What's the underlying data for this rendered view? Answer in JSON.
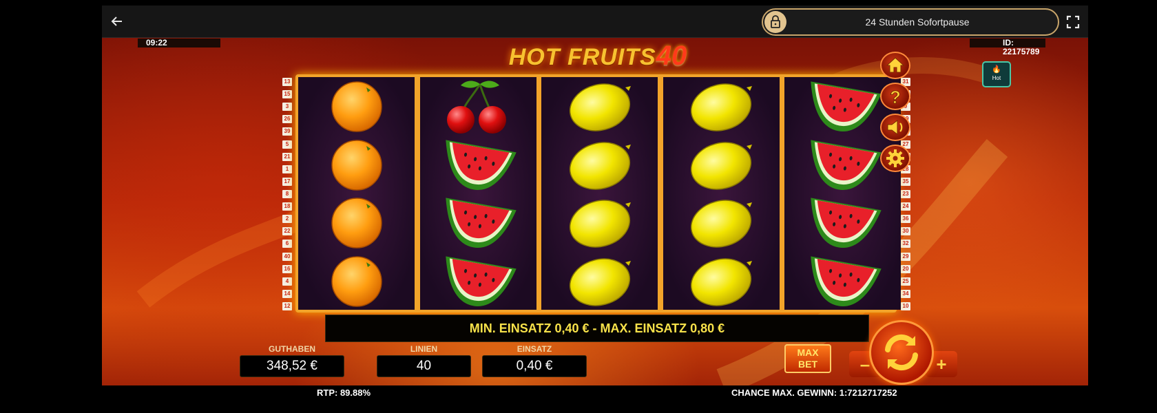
{
  "topbar": {
    "back_icon": "arrow-left-icon",
    "pause_label": "24 Stunden Sofortpause",
    "lock_icon": "lock-icon",
    "fullscreen_icon": "fullscreen-icon"
  },
  "hud": {
    "clock": "09:22",
    "game_id": "ID: 22175789"
  },
  "logo": {
    "text": "HOT FRUITS",
    "number": "40"
  },
  "paylines": {
    "left": [
      "13",
      "15",
      "3",
      "26",
      "39",
      "5",
      "21",
      "1",
      "17",
      "8",
      "18",
      "2",
      "22",
      "6",
      "40",
      "16",
      "4",
      "14",
      "12"
    ],
    "right": [
      "31",
      "11",
      "9",
      "19",
      "37",
      "27",
      "33",
      "28",
      "35",
      "23",
      "24",
      "36",
      "30",
      "32",
      "29",
      "20",
      "25",
      "34",
      "10"
    ]
  },
  "reels": [
    [
      "orange",
      "orange",
      "orange",
      "orange"
    ],
    [
      "cherry",
      "watermelon",
      "watermelon",
      "watermelon"
    ],
    [
      "lemon",
      "lemon",
      "lemon",
      "lemon"
    ],
    [
      "lemon",
      "lemon",
      "lemon",
      "lemon"
    ],
    [
      "watermelon",
      "watermelon",
      "watermelon",
      "watermelon"
    ]
  ],
  "info_bar": "MIN. EINSATZ 0,40 € - MAX. EINSATZ 0,80 €",
  "stats": {
    "balance_label": "GUTHABEN",
    "balance_value": "348,52 €",
    "lines_label": "LINIEN",
    "lines_value": "40",
    "bet_label": "EINSATZ",
    "bet_value": "0,40 €"
  },
  "controls": {
    "maxbet_line1": "MAX",
    "maxbet_line2": "BET",
    "minus": "–",
    "plus": "+",
    "spin_icon": "refresh-icon"
  },
  "side_buttons": [
    "home-icon",
    "help-icon",
    "sound-icon",
    "settings-icon"
  ],
  "hot_badge": {
    "icon": "flame-icon",
    "label": "Hot"
  },
  "footer": {
    "rtp": "RTP: 89.88%",
    "chance": "CHANCE MAX. GEWINN: 1:7212717252"
  },
  "colors": {
    "frame_gold": "#f2a42a",
    "info_text": "#f8e24a",
    "pill_border": "#c9a56a",
    "hot_badge": "#0f3b3a"
  }
}
